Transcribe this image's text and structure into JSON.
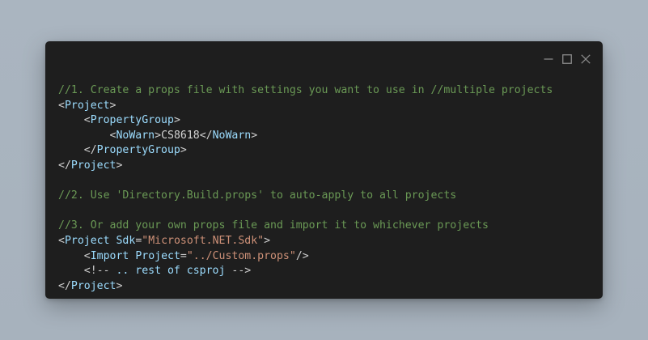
{
  "window": {
    "controls": {
      "minimize_icon": "minimize-icon",
      "maximize_icon": "maximize-icon",
      "close_icon": "close-icon"
    }
  },
  "colors": {
    "background": "#a9b4bf",
    "editor_bg": "#1e1e1e",
    "comment": "#6a9955",
    "tag": "#9cdcfe",
    "string": "#ce9178",
    "punctuation": "#cfcfcf"
  },
  "code": {
    "lines": [
      [
        {
          "t": "comment",
          "v": "//1. Create a props file with settings you want to use in //multiple projects"
        }
      ],
      [
        {
          "t": "punct",
          "v": "<"
        },
        {
          "t": "tag",
          "v": "Project"
        },
        {
          "t": "punct",
          "v": ">"
        }
      ],
      [
        {
          "t": "text",
          "v": "    "
        },
        {
          "t": "punct",
          "v": "<"
        },
        {
          "t": "tag",
          "v": "PropertyGroup"
        },
        {
          "t": "punct",
          "v": ">"
        }
      ],
      [
        {
          "t": "text",
          "v": "        "
        },
        {
          "t": "punct",
          "v": "<"
        },
        {
          "t": "tag",
          "v": "NoWarn"
        },
        {
          "t": "punct",
          "v": ">"
        },
        {
          "t": "text",
          "v": "CS8618"
        },
        {
          "t": "punct",
          "v": "</"
        },
        {
          "t": "tag",
          "v": "NoWarn"
        },
        {
          "t": "punct",
          "v": ">"
        }
      ],
      [
        {
          "t": "text",
          "v": "    "
        },
        {
          "t": "punct",
          "v": "</"
        },
        {
          "t": "tag",
          "v": "PropertyGroup"
        },
        {
          "t": "punct",
          "v": ">"
        }
      ],
      [
        {
          "t": "punct",
          "v": "</"
        },
        {
          "t": "tag",
          "v": "Project"
        },
        {
          "t": "punct",
          "v": ">"
        }
      ],
      [],
      [
        {
          "t": "comment",
          "v": "//2. Use 'Directory.Build.props' to auto-apply to all projects"
        }
      ],
      [],
      [
        {
          "t": "comment",
          "v": "//3. Or add your own props file and import it to whichever projects"
        }
      ],
      [
        {
          "t": "punct",
          "v": "<"
        },
        {
          "t": "tag",
          "v": "Project"
        },
        {
          "t": "text",
          "v": " "
        },
        {
          "t": "attr",
          "v": "Sdk"
        },
        {
          "t": "punct",
          "v": "="
        },
        {
          "t": "string",
          "v": "\"Microsoft.NET.Sdk\""
        },
        {
          "t": "punct",
          "v": ">"
        }
      ],
      [
        {
          "t": "text",
          "v": "    "
        },
        {
          "t": "punct",
          "v": "<"
        },
        {
          "t": "tag",
          "v": "Import"
        },
        {
          "t": "text",
          "v": " "
        },
        {
          "t": "attr",
          "v": "Project"
        },
        {
          "t": "punct",
          "v": "="
        },
        {
          "t": "string",
          "v": "\"../Custom.props\""
        },
        {
          "t": "punct",
          "v": "/>"
        }
      ],
      [
        {
          "t": "text",
          "v": "    "
        },
        {
          "t": "punct",
          "v": "<!-- "
        },
        {
          "t": "tag",
          "v": ".. rest of csproj"
        },
        {
          "t": "punct",
          "v": " -->"
        }
      ],
      [
        {
          "t": "punct",
          "v": "</"
        },
        {
          "t": "tag",
          "v": "Project"
        },
        {
          "t": "punct",
          "v": ">"
        }
      ]
    ]
  }
}
